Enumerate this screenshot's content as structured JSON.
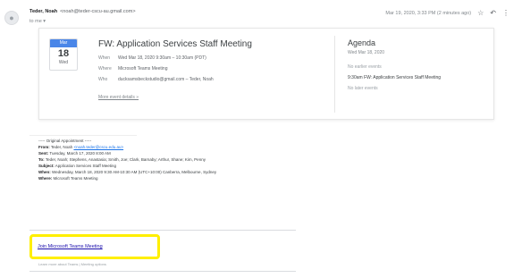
{
  "header": {
    "avatar_glyph": "●",
    "sender_name": "Teder, Noah",
    "sender_email": "<noah@teder-cscu-au.gmail.com>",
    "to_line": "to me ▾",
    "timestamp": "Mar 19, 2020, 3:33 PM (2 minutes ago)",
    "star_icon": "☆",
    "reply_icon": "↶",
    "more_icon": "⋮"
  },
  "invite": {
    "month": "Mar",
    "day": "18",
    "weekday": "Wed",
    "title": "FW: Application Services Staff Meeting",
    "rows": [
      {
        "key": "When",
        "value": "Wed Mar 18, 2020 9:30am – 10:30am (PDT)"
      },
      {
        "key": "Where",
        "value": "Microsoft Teams Meeting"
      },
      {
        "key": "Who",
        "value": "ducksamsbeckstudio@gmail.com – Teder, Noah"
      }
    ],
    "more_details": "More event details »",
    "agenda": {
      "title": "Agenda",
      "date": "Wed Mar 18, 2020",
      "items": [
        {
          "text": "No earlier events",
          "muted": true
        },
        {
          "text": "9:30am   FW: Application Services Staff Meeting",
          "muted": false
        },
        {
          "text": "No later events",
          "muted": true
        }
      ]
    }
  },
  "body": {
    "orig_header": "----- Original Appointment -----",
    "from_label": "From:",
    "from_value": "Teder, Noah",
    "from_email": "<noah.teder@cscu.edu.au>",
    "sent_label": "Sent:",
    "sent_value": "Tuesday, March 17, 2020 8:00 AM",
    "to_label": "To:",
    "to_value": "Teder, Noah; Stephens, Anastasia; Smith, Joe; Clark, Barnaby; Arthur, Shane; Kim, Penny",
    "subject_label": "Subject:",
    "subject_value": "Application Services Staff Meeting",
    "when_label": "When:",
    "when_value": "Wednesday, March 18, 2020 9:30 AM-10:30 AM (UTC+10:00) Canberra, Melbourne, Sydney",
    "where_label": "Where:",
    "where_value": "Microsoft Teams Meeting",
    "join_link": "Join Microsoft Teams Meeting",
    "join_sub": "Learn more about Teams | Meeting options"
  }
}
